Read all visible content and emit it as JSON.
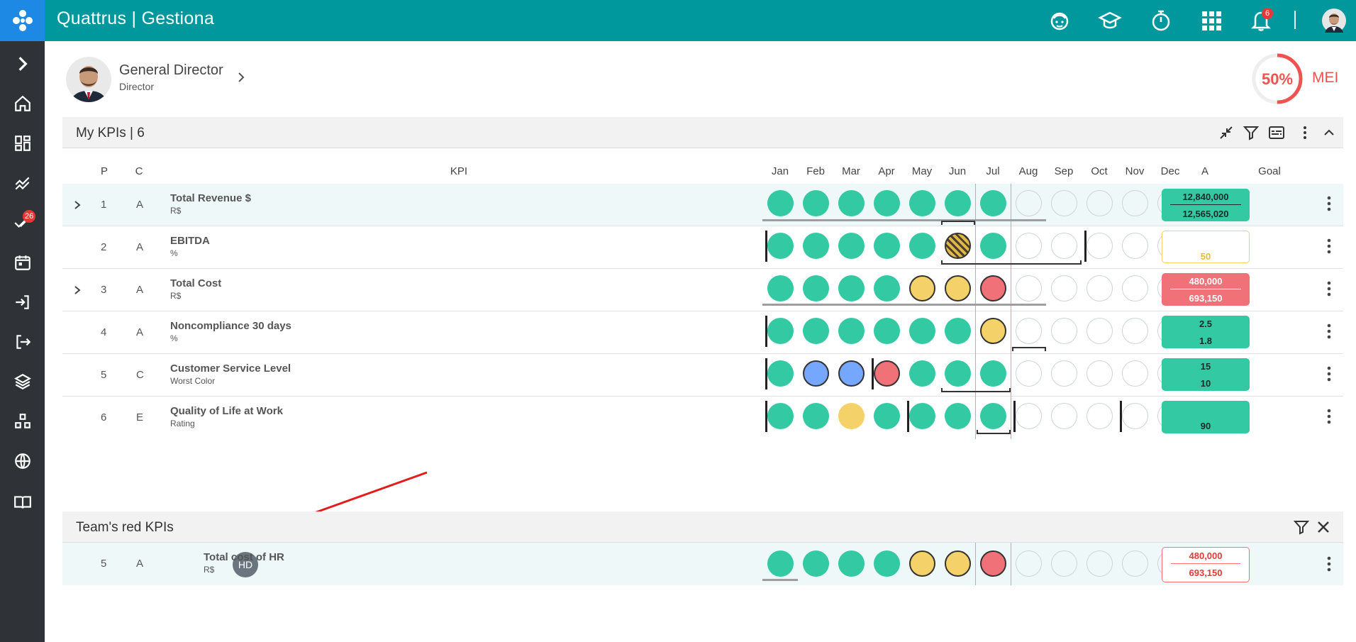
{
  "app": {
    "title": "Quattrus | Gestiona"
  },
  "sidebar": {
    "badge_count": "26"
  },
  "topbar": {
    "notification_count": "6"
  },
  "profile": {
    "name": "General Director",
    "role": "Director",
    "mei_percent": "50%",
    "mei_value": 0.5,
    "mei_label": "MEI"
  },
  "kpis_section": {
    "title": "My KPIs | 6"
  },
  "columns": {
    "p": "P",
    "c": "C",
    "kpi": "KPI",
    "months": [
      "Jan",
      "Feb",
      "Mar",
      "Apr",
      "May",
      "Jun",
      "Jul",
      "Aug",
      "Sep",
      "Oct",
      "Nov",
      "Dec"
    ],
    "a": "A",
    "goal": "Goal"
  },
  "rows": [
    {
      "p": "1",
      "c": "A",
      "name": "Total Revenue $",
      "unit": "R$",
      "goal_top": "12,840,000",
      "goal_bottom": "12,565,020"
    },
    {
      "p": "2",
      "c": "A",
      "name": "EBITDA",
      "unit": "%",
      "goal_single": "50"
    },
    {
      "p": "3",
      "c": "A",
      "name": "Total Cost",
      "unit": "R$",
      "goal_top": "480,000",
      "goal_bottom": "693,150"
    },
    {
      "p": "4",
      "c": "A",
      "name": "Noncompliance 30 days",
      "unit": "%",
      "goal_top": "2.5",
      "goal_bottom": "1.8"
    },
    {
      "p": "5",
      "c": "C",
      "name": "Customer Service Level",
      "unit": "Worst Color",
      "goal_top": "15",
      "goal_bottom": "10"
    },
    {
      "p": "6",
      "c": "E",
      "name": "Quality of Life at Work",
      "unit": "Rating",
      "goal_single": "90"
    }
  ],
  "team_section": {
    "title": "Team's red KPIs",
    "row": {
      "p": "5",
      "c": "A",
      "avatar_initials": "HD",
      "name": "Total cost of HR",
      "unit": "R$",
      "goal_top": "480,000",
      "goal_bottom": "693,150"
    }
  }
}
